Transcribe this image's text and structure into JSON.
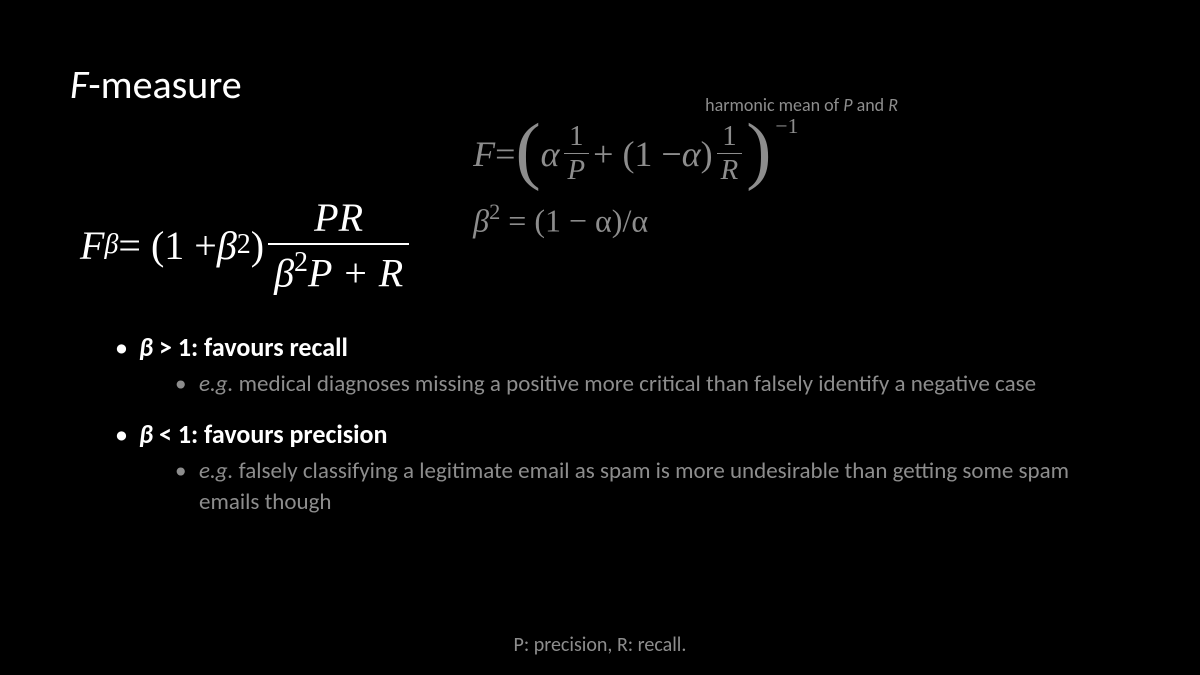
{
  "title_prefix": "F",
  "title_suffix": "-measure",
  "harmonic_label_pre": "harmonic mean of ",
  "harmonic_label_P": "P",
  "harmonic_label_mid": " and ",
  "harmonic_label_R": "R",
  "fbeta": {
    "F": "F",
    "beta": "β",
    "eq": " = (1 + ",
    "beta2": "β",
    "sq": "2",
    "close": ")",
    "num": "PR",
    "den_pre": "β",
    "den_sq": "2",
    "den_rest": "P + R"
  },
  "falpha": {
    "F": "F",
    "eq": " = ",
    "alpha1": "α",
    "one1": "1",
    "P": "P",
    "plus": " + (1 − ",
    "alpha2": "α",
    "close": ")",
    "one2": "1",
    "R": "R",
    "neg1": "−1"
  },
  "beta_alpha": {
    "beta": "β",
    "sq": "2",
    "rest": " = (1 − α)/α"
  },
  "bullets": [
    {
      "head_beta": "β",
      "head_rest": " > 1: favours recall",
      "sub_eg": "e.g.",
      "sub_rest": " medical diagnoses missing a positive more critical than falsely identify a negative case"
    },
    {
      "head_beta": "β",
      "head_rest": " < 1: favours precision",
      "sub_eg": "e.g.",
      "sub_rest": " falsely classifying a legitimate email as spam is more undesirable than getting some spam emails though"
    }
  ],
  "footer": "P: precision, R: recall."
}
